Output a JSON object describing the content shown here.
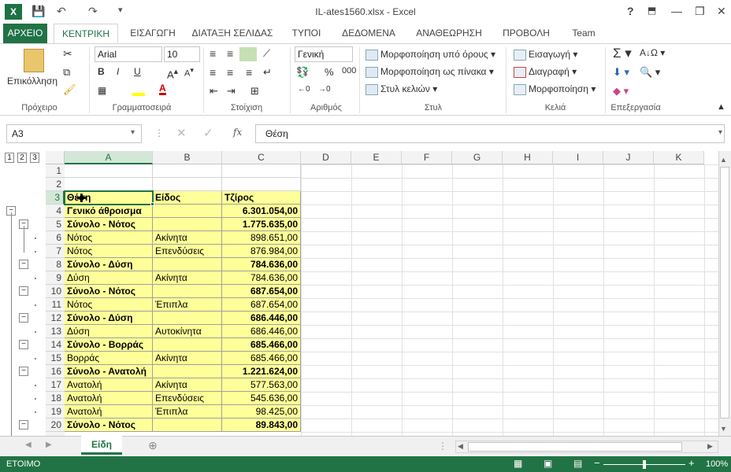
{
  "window": {
    "title": "IL-ates1560.xlsx - Excel",
    "help": "?",
    "min": "—",
    "max": "❐",
    "close": "✕"
  },
  "qat": {
    "save": "💾",
    "undo": "↶",
    "redo": "↷",
    "more": "▾"
  },
  "tabs": [
    "ΑΡΧΕΙΟ",
    "ΚΕΝΤΡΙΚΗ",
    "ΕΙΣΑΓΩΓΗ",
    "ΔΙΑΤΑΞΗ ΣΕΛΙΔΑΣ",
    "ΤΥΠΟΙ",
    "ΔΕΔΟΜΕΝΑ",
    "ΑΝΑΘΕΩΡΗΣΗ",
    "ΠΡΟΒΟΛΗ",
    "Team"
  ],
  "ribbon": {
    "paste": "Επικόλληση",
    "font_name": "Arial",
    "font_size": "10",
    "number_format": "Γενική",
    "cond_format": "Μορφοποίηση υπό όρους",
    "format_table": "Μορφοποίηση ως πίνακα",
    "cell_styles": "Στυλ κελιών",
    "insert": "Εισαγωγή",
    "delete": "Διαγραφή",
    "format": "Μορφοποίηση",
    "groups": [
      "Πρόχειρο",
      "Γραμματοσειρά",
      "Στοίχιση",
      "Αριθμός",
      "Στυλ",
      "Κελιά",
      "Επεξεργασία"
    ]
  },
  "formula": {
    "namebox": "A3",
    "value": "Θέση"
  },
  "outline_levels": [
    "1",
    "2",
    "3"
  ],
  "columns": [
    "A",
    "B",
    "C",
    "D",
    "E",
    "F",
    "G",
    "H",
    "I",
    "J",
    "K"
  ],
  "rows": [
    {
      "n": "1",
      "a": "",
      "b": "",
      "c": ""
    },
    {
      "n": "2",
      "a": "",
      "b": "",
      "c": ""
    },
    {
      "n": "3",
      "a": "Θέση",
      "b": "Είδος",
      "c": "Τζίρος"
    },
    {
      "n": "4",
      "a": "Γενικό άθροισμα",
      "b": "",
      "c": "6.301.054,00"
    },
    {
      "n": "5",
      "a": "Σύνολο - Νότος",
      "b": "",
      "c": "1.775.635,00"
    },
    {
      "n": "6",
      "a": "Νότος",
      "b": "Ακίνητα",
      "c": "898.651,00"
    },
    {
      "n": "7",
      "a": "Νότος",
      "b": "Επενδύσεις",
      "c": "876.984,00"
    },
    {
      "n": "8",
      "a": "Σύνολο - Δύση",
      "b": "",
      "c": "784.636,00"
    },
    {
      "n": "9",
      "a": "Δύση",
      "b": "Ακίνητα",
      "c": "784.636,00"
    },
    {
      "n": "10",
      "a": "Σύνολο - Νότος",
      "b": "",
      "c": "687.654,00"
    },
    {
      "n": "11",
      "a": "Νότος",
      "b": "Έπιπλα",
      "c": "687.654,00"
    },
    {
      "n": "12",
      "a": "Σύνολο - Δύση",
      "b": "",
      "c": "686.446,00"
    },
    {
      "n": "13",
      "a": "Δύση",
      "b": "Αυτοκίνητα",
      "c": "686.446,00"
    },
    {
      "n": "14",
      "a": "Σύνολο - Βορράς",
      "b": "",
      "c": "685.466,00"
    },
    {
      "n": "15",
      "a": "Βορράς",
      "b": "Ακίνητα",
      "c": "685.466,00"
    },
    {
      "n": "16",
      "a": "Σύνολο - Ανατολή",
      "b": "",
      "c": "1.221.624,00"
    },
    {
      "n": "17",
      "a": "Ανατολή",
      "b": "Ακίνητα",
      "c": "577.563,00"
    },
    {
      "n": "18",
      "a": "Ανατολή",
      "b": "Επενδύσεις",
      "c": "545.636,00"
    },
    {
      "n": "19",
      "a": "Ανατολή",
      "b": "Έπιπλα",
      "c": "98.425,00"
    },
    {
      "n": "20",
      "a": "Σύνολο - Νότος",
      "b": "",
      "c": "89.843,00"
    }
  ],
  "sheet_tab": "Είδη",
  "status": {
    "ready": "ΕΤΟΙΜΟ",
    "zoom": "100%"
  }
}
